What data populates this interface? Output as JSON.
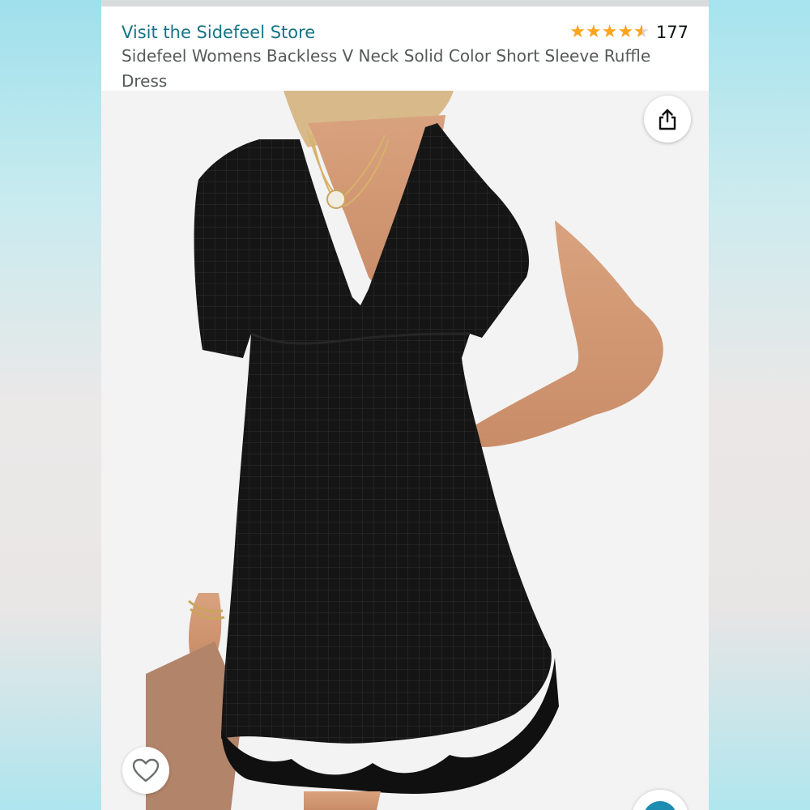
{
  "header": {
    "store_link": "Visit the Sidefeel Store",
    "rating_count": "177",
    "rating_stars": 4.5,
    "title": "Sidefeel Womens Backless V Neck Solid Color Short Sleeve Ruffle Dress"
  },
  "icons": {
    "share": "share-icon",
    "wishlist": "heart-icon",
    "star": "star-icon"
  },
  "colors": {
    "link": "#167486",
    "star": "#ffa41c",
    "text": "#565959",
    "dress": "#141414"
  }
}
